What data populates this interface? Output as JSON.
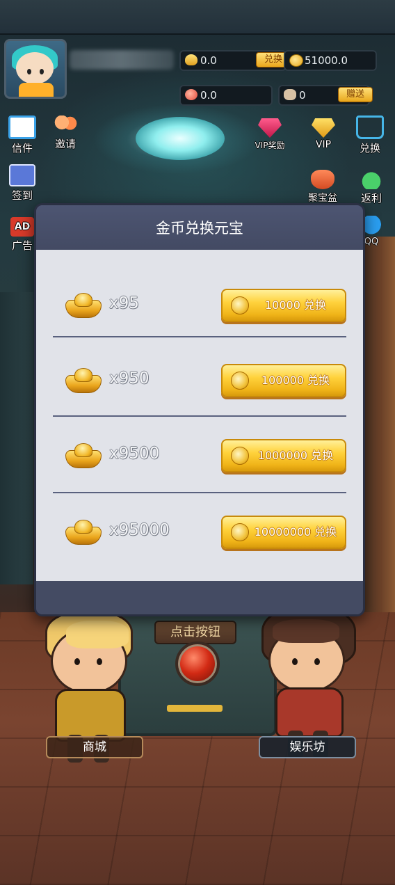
{
  "hud": {
    "gold_ingot_value": "0.0",
    "exchange_mini_label": "兑换",
    "coin_value": "51000.0",
    "peach_value": "0.0",
    "hand_value": "0",
    "gift_mini_label": "赠送"
  },
  "side_menu": {
    "mail": "信件",
    "invite": "邀请",
    "vip_award": "VIP奖励",
    "vip": "VIP",
    "exchange": "兑换",
    "sign_in": "签到",
    "treasure_bowl": "聚宝盆",
    "rebate": "返利",
    "ad_badge": "AD",
    "ad": "广告",
    "qq": "QQ"
  },
  "modal": {
    "title": "金币兑换元宝",
    "rows": [
      {
        "amount": "x95",
        "button": "10000 兑换"
      },
      {
        "amount": "x950",
        "button": "100000 兑换"
      },
      {
        "amount": "x9500",
        "button": "1000000 兑换"
      },
      {
        "amount": "x95000",
        "button": "10000000 兑换"
      }
    ]
  },
  "scene": {
    "machine_label": "点击按钮",
    "shop_label": "商城",
    "entertainment_label": "娱乐坊"
  }
}
